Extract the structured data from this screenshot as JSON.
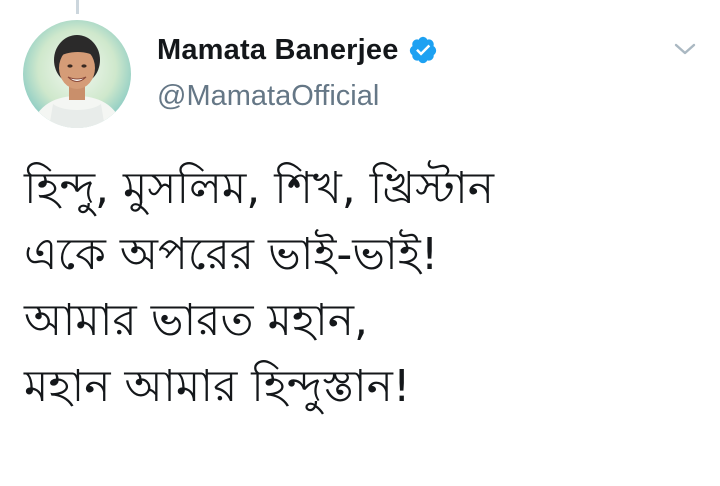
{
  "tweet": {
    "author": {
      "display_name": "Mamata Banerjee",
      "handle": "@MamataOfficial",
      "verified": true,
      "avatar_icon": "profile-photo"
    },
    "menu_icon": "chevron-down-icon",
    "lines": [
      "হিন্দু, মুসলিম, শিখ, খ্রিস্টান",
      "একে অপরের ভাই-ভাই!",
      "আমার ভারত মহান,",
      "মহান আমার হিন্দুস্তান!"
    ]
  },
  "colors": {
    "verified_blue": "#1da1f2",
    "handle_gray": "#657786",
    "text": "#14171a",
    "chevron_gray": "#aab8c2"
  }
}
